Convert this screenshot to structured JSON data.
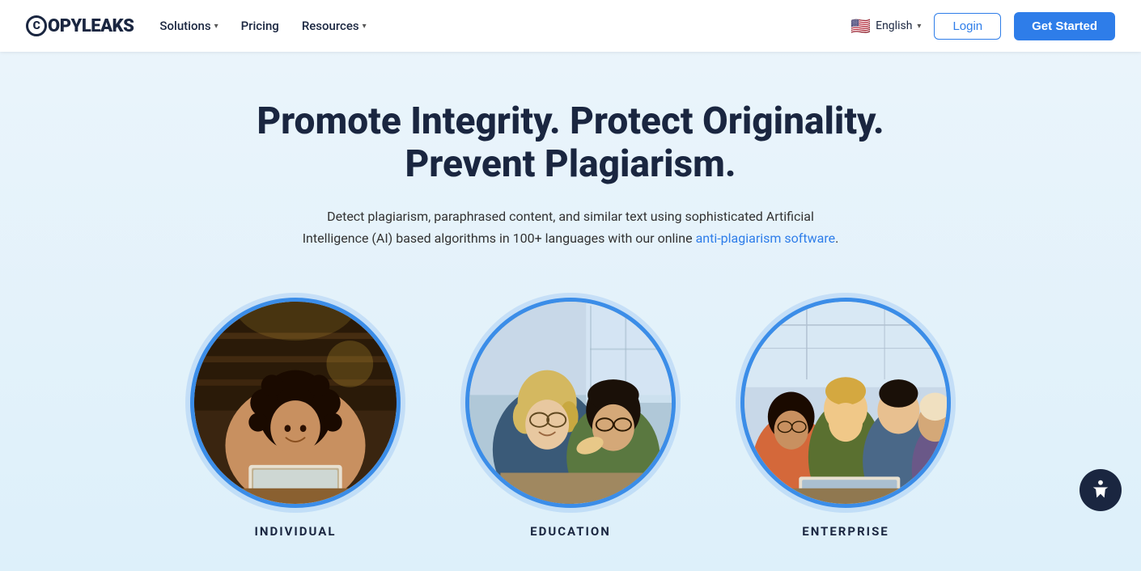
{
  "navbar": {
    "logo_text": "COPYLEAKS",
    "logo_letter": "C",
    "nav_items": [
      {
        "label": "Solutions",
        "has_dropdown": true
      },
      {
        "label": "Pricing",
        "has_dropdown": false
      },
      {
        "label": "Resources",
        "has_dropdown": true
      }
    ],
    "lang": {
      "code": "English",
      "flag": "🇺🇸"
    },
    "btn_login": "Login",
    "btn_get_started": "Get Started"
  },
  "hero": {
    "title": "Promote Integrity. Protect Originality. Prevent Plagiarism.",
    "subtitle_before_link": "Detect plagiarism, paraphrased content, and similar text using sophisticated Artificial Intelligence (AI) based algorithms in 100+ languages with our online ",
    "subtitle_link_text": "anti-plagiarism software",
    "subtitle_after_link": "."
  },
  "circles": [
    {
      "id": "individual",
      "label": "INDIVIDUAL"
    },
    {
      "id": "education",
      "label": "EDUCATION"
    },
    {
      "id": "enterprise",
      "label": "ENTERPRISE"
    }
  ],
  "accessibility_label": "Accessibility"
}
